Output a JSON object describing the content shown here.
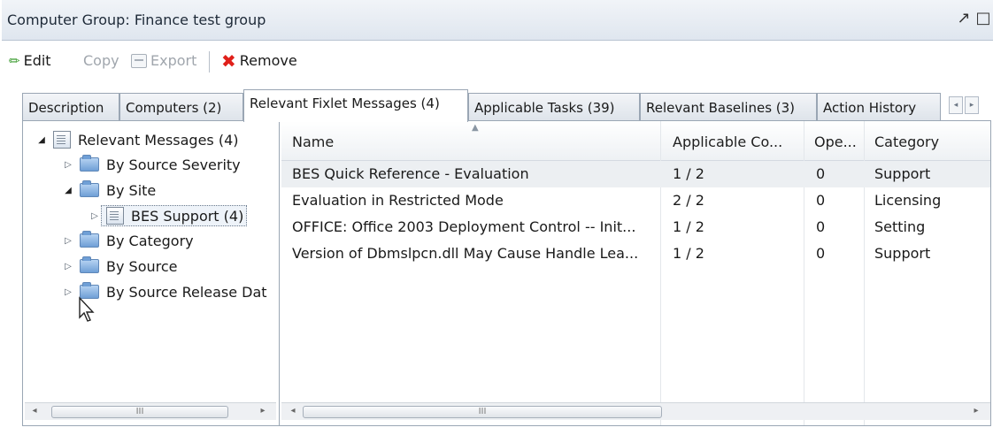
{
  "window": {
    "title": "Computer Group: Finance test group",
    "icons": [
      "detach-icon",
      "maximize-icon"
    ]
  },
  "toolbar": {
    "edit": "Edit",
    "copy": "Copy",
    "export": "Export",
    "remove": "Remove"
  },
  "tabs": [
    {
      "label": "Description",
      "active": false
    },
    {
      "label": "Computers (2)",
      "active": false
    },
    {
      "label": "Relevant Fixlet Messages (4)",
      "active": true
    },
    {
      "label": "Applicable Tasks (39)",
      "active": false
    },
    {
      "label": "Relevant Baselines (3)",
      "active": false
    },
    {
      "label": "Action History",
      "active": false
    }
  ],
  "tree": {
    "root": "Relevant Messages (4)",
    "items": [
      {
        "label": "By Source Severity",
        "expanded": false
      },
      {
        "label": "By Site",
        "expanded": true
      },
      {
        "label": "BES Support (4)",
        "expanded": false,
        "selected": true
      },
      {
        "label": "By Category",
        "expanded": false
      },
      {
        "label": "By Source",
        "expanded": false
      },
      {
        "label": "By Source Release Dat",
        "expanded": false
      }
    ]
  },
  "list": {
    "columns": [
      "Name",
      "Applicable Co...",
      "Ope...",
      "Category"
    ],
    "rows": [
      {
        "name": "BES Quick Reference - Evaluation",
        "applicable": "1 / 2",
        "open": "0",
        "category": "Support",
        "selected": true
      },
      {
        "name": "Evaluation in Restricted Mode",
        "applicable": "2 / 2",
        "open": "0",
        "category": "Licensing",
        "selected": false
      },
      {
        "name": "OFFICE: Office 2003 Deployment Control -- Init...",
        "applicable": "1 / 2",
        "open": "0",
        "category": "Setting",
        "selected": false
      },
      {
        "name": "Version of Dbmslpcn.dll May Cause Handle Lea...",
        "applicable": "1 / 2",
        "open": "0",
        "category": "Support",
        "selected": false
      }
    ]
  },
  "scrollbar_grip": "III",
  "colors": {
    "remove": "#e0201a",
    "edit": "#3b9b2f",
    "folder": "#6f9fd6"
  }
}
